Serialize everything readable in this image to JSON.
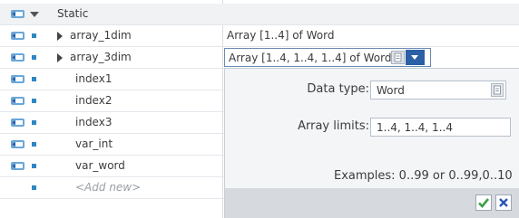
{
  "table": {
    "section": "Static",
    "rows": [
      {
        "name": "array_1dim",
        "type": "Array [1..4] of Word"
      },
      {
        "name": "array_3dim",
        "type": "Array [1..4, 1..4, 1..4] of Word"
      },
      {
        "name": "index1",
        "type": ""
      },
      {
        "name": "index2",
        "type": ""
      },
      {
        "name": "index3",
        "type": ""
      },
      {
        "name": "var_int",
        "type": ""
      },
      {
        "name": "var_word",
        "type": ""
      }
    ],
    "add_new": "<Add new>"
  },
  "popup": {
    "data_type_label": "Data type:",
    "data_type_value": "Word",
    "array_limits_label": "Array limits:",
    "array_limits_value": "1..4, 1..4, 1..4",
    "examples_text": "Examples: 0..99 or 0..99,0..10"
  },
  "colors": {
    "accent": "#2b5fa6",
    "bullet": "#2f86c4",
    "ok_green": "#3aa14a",
    "cancel_blue": "#2a56b5"
  },
  "icons": {
    "interface": "interface-icon",
    "ok": "checkmark-icon",
    "cancel": "close-icon"
  }
}
